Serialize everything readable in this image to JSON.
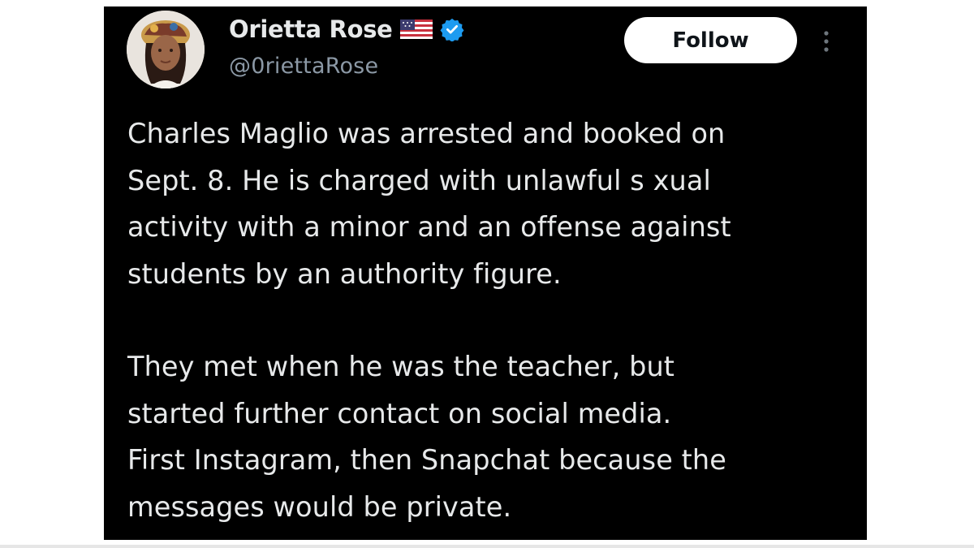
{
  "user": {
    "display_name": "Orietta Rose",
    "handle": "@0riettaRose",
    "flag_icon": "us-flag-icon",
    "verified_icon": "verified-badge-icon",
    "verified_color": "#1d9bf0"
  },
  "actions": {
    "follow_label": "Follow",
    "more_icon": "more-options-icon"
  },
  "tweet": {
    "paragraphs": [
      "Charles Maglio was arrested and booked on\nSept. 8. He is charged with unlawful s  xual\nactivity with a minor and an offense against\nstudents by an authority figure.",
      "They met when he was the teacher, but\nstarted further contact on social media.\nFirst Instagram, then Snapchat because the\nmessages would be private."
    ]
  },
  "colors": {
    "card_background": "#000000",
    "text_primary": "#e7e9ea",
    "text_secondary": "#8b98a5",
    "follow_button_bg": "#ffffff",
    "follow_button_text": "#0f1419"
  }
}
